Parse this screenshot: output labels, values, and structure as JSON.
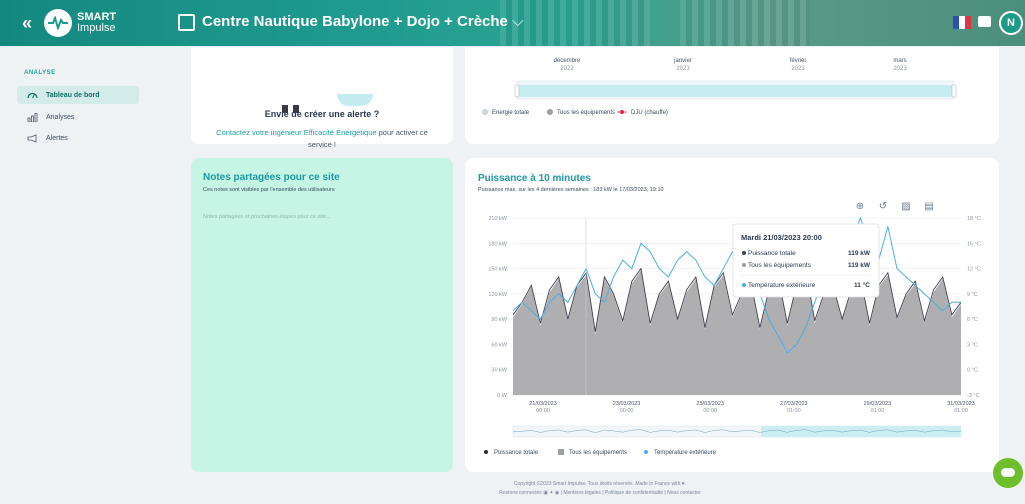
{
  "header": {
    "logo_line1": "SMART",
    "logo_line2": "Impulse",
    "site_title": "Centre Nautique Babylone + Dojo + Crèche",
    "avatar_initial": "N"
  },
  "sidebar": {
    "section": "ANALYSE",
    "items": [
      {
        "label": "Tableau de bord",
        "icon": "gauge-icon",
        "active": true
      },
      {
        "label": "Analyses",
        "icon": "bar-chart-icon",
        "active": false
      },
      {
        "label": "Alertes",
        "icon": "megaphone-icon",
        "active": false
      }
    ]
  },
  "alert_card": {
    "title": "Envie de créer une alerte ?",
    "link_text": "Contactez votre ingénieur Efficacité Énergétique",
    "text_after": " pour activer ce service !"
  },
  "energy_card": {
    "months": [
      {
        "month": "décembre",
        "year": "2022"
      },
      {
        "month": "janvier",
        "year": "2023"
      },
      {
        "month": "février",
        "year": "2023"
      },
      {
        "month": "mars",
        "year": "2023"
      }
    ],
    "legend": [
      "Energie totale",
      "Tous les équipements",
      "DJU (chauffe)"
    ]
  },
  "notes_card": {
    "title": "Notes partagées pour ce site",
    "subtitle": "Ces notes sont visibles par l'ensemble des utilisateurs",
    "placeholder": "Notes partagées et prochaines étapes pour ce site..."
  },
  "power_card": {
    "title": "Puissance à 10 minutes",
    "subtitle": "Puissance max. sur les 4 dernières semaines : 183 kW le 17/03/2023, 19:10"
  },
  "chart_data": {
    "type": "line",
    "y_left_ticks": [
      "210 kW",
      "180 kW",
      "150 kW",
      "120 kW",
      "90 kW",
      "60 kW",
      "30 kW",
      "0 W"
    ],
    "y_right_ticks": [
      "18 °C",
      "15 °C",
      "12 °C",
      "9 °C",
      "6 °C",
      "3 °C",
      "0 °C",
      "-3 °C"
    ],
    "x_ticks": [
      {
        "date": "21/03/2023",
        "time": "00:00"
      },
      {
        "date": "23/03/2023",
        "time": "00:00"
      },
      {
        "date": "25/03/2023",
        "time": "00:00"
      },
      {
        "date": "27/03/2023",
        "time": "01:00"
      },
      {
        "date": "29/03/2023",
        "time": "01:00"
      },
      {
        "date": "31/03/2023",
        "time": "01:00"
      }
    ],
    "ylim_power_kw": [
      0,
      210
    ],
    "ylim_temp_c": [
      -3,
      18
    ],
    "series": [
      {
        "name": "Puissance totale",
        "color": "#3d3d4d",
        "values_kw": [
          95,
          110,
          130,
          85,
          125,
          140,
          90,
          130,
          145,
          75,
          140,
          120,
          88,
          135,
          150,
          85,
          120,
          135,
          90,
          125,
          140,
          80,
          130,
          145,
          95,
          120,
          135,
          80,
          125,
          140,
          85,
          130,
          150,
          88,
          120,
          130,
          90,
          125,
          140,
          85,
          130,
          145,
          92,
          120,
          135,
          88,
          125,
          140,
          95,
          110
        ]
      },
      {
        "name": "Tous les équipements",
        "color": "#9e9e9e",
        "values_kw": [
          92,
          108,
          128,
          82,
          122,
          138,
          88,
          128,
          142,
          72,
          138,
          118,
          85,
          132,
          148,
          82,
          118,
          132,
          88,
          122,
          138,
          78,
          128,
          142,
          92,
          118,
          132,
          78,
          122,
          138,
          82,
          128,
          148,
          85,
          118,
          128,
          88,
          122,
          138,
          82,
          128,
          142,
          90,
          118,
          132,
          85,
          122,
          138,
          92,
          108
        ]
      },
      {
        "name": "Température extérieure",
        "color": "#4aaee0",
        "values_c": [
          7,
          8,
          7,
          6,
          8,
          9,
          8,
          10,
          12,
          9,
          8,
          11,
          13,
          12,
          15,
          14,
          12,
          11,
          13,
          14,
          13,
          11,
          10,
          12,
          14,
          13,
          11,
          9,
          6,
          4,
          2,
          3,
          5,
          8,
          11,
          12,
          14,
          15,
          18,
          15,
          13,
          17,
          12,
          11,
          10,
          9,
          8,
          7,
          8,
          8
        ]
      }
    ],
    "tooltip": {
      "title": "Mardi 21/03/2023 20:00",
      "rows": [
        {
          "label": "Puissance totale",
          "value": "119 kW",
          "color": "#3d3d4d"
        },
        {
          "label": "Tous les équipements",
          "value": "119 kW",
          "color": "#9e9e9e"
        },
        {
          "label": "Température extérieure",
          "value": "11 °C",
          "color": "#4aaee0"
        }
      ]
    },
    "legend": [
      "Puissance totale",
      "Tous les équipements",
      "Température extérieure"
    ],
    "grid": true,
    "legend_position": "bottom-left"
  },
  "footer": {
    "line1": "Copyright ©2023 Smart Impulse, Tous droits réservés. Made in France with ♥.",
    "line2": "Restons connectés",
    "line2_links": "| Mentions légales | Politique de confidentialité | Nous contacter"
  }
}
